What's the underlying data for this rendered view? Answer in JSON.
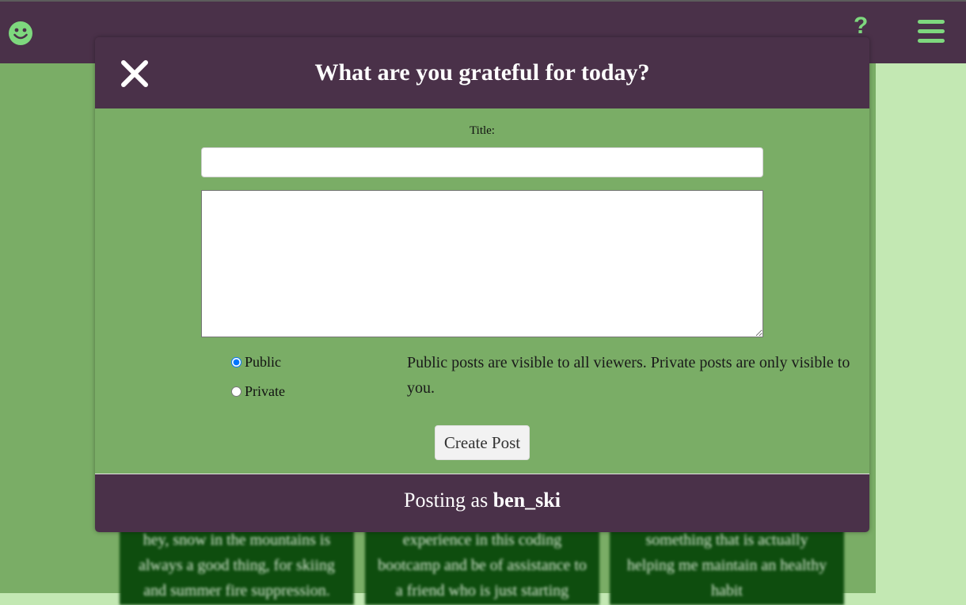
{
  "navbar": {
    "logo_icon": "smiley-icon",
    "help_label": "?",
    "menu_icon": "hamburger-menu-icon",
    "accent_color": "#7ed87e",
    "bg_color": "#4a3149"
  },
  "background_cards": [
    {
      "text": "hey, snow in the mountains is always a good thing, for skiing and summer fire suppression."
    },
    {
      "text": "experience in this coding bootcamp and be of assistance to a friend who is just starting"
    },
    {
      "text": "something that is actually helping me maintain an healthy habit"
    }
  ],
  "modal": {
    "title": "What are you grateful for today?",
    "close_icon": "close-x-icon",
    "form": {
      "title_label": "Title:",
      "title_value": "",
      "body_value": "",
      "visibility_options": [
        {
          "label": "Public",
          "checked": true
        },
        {
          "label": "Private",
          "checked": false
        }
      ],
      "visibility_note": "Public posts are visible to all viewers. Private posts are only visible to you.",
      "submit_label": "Create Post"
    },
    "footer": {
      "prefix": "Posting as ",
      "username": "ben_ski"
    }
  },
  "colors": {
    "header_purple": "#4a3149",
    "body_green": "#7aad66",
    "card_green": "#0e4d0e",
    "side_green": "#c3e8b3"
  }
}
